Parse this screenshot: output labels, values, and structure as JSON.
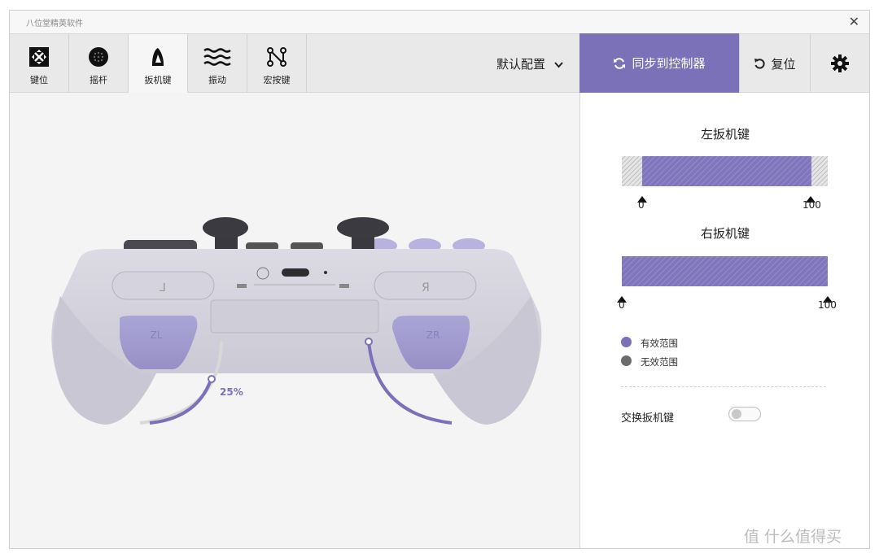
{
  "app": {
    "title": "八位堂精英软件"
  },
  "tabs": [
    {
      "label": "键位",
      "icon": "button-map-icon"
    },
    {
      "label": "摇杆",
      "icon": "joystick-icon"
    },
    {
      "label": "扳机键",
      "icon": "trigger-icon"
    },
    {
      "label": "振动",
      "icon": "vibration-icon"
    },
    {
      "label": "宏按键",
      "icon": "macro-icon"
    }
  ],
  "toolbar": {
    "profile_label": "默认配置",
    "sync_label": "同步到控制器",
    "reset_label": "复位"
  },
  "controller": {
    "left_trigger_percent_label": "25%",
    "left_trigger_travel": 0.25,
    "right_trigger_travel": 0.0
  },
  "triggers": {
    "left": {
      "title": "左扳机键",
      "min_label": "0",
      "max_label": "100",
      "min": 0,
      "max": 100,
      "dead_low": 10,
      "dead_high": 8
    },
    "right": {
      "title": "右扳机键",
      "min_label": "0",
      "max_label": "100",
      "min": 0,
      "max": 100,
      "dead_low": 0,
      "dead_high": 0
    }
  },
  "legend": {
    "effective": "有效范围",
    "ineffective": "无效范围"
  },
  "swap": {
    "label": "交换扳机键",
    "enabled": false
  },
  "colors": {
    "accent": "#7a71b8",
    "ineffective": "#6b6b6b",
    "controller_body": "#cfcdd8",
    "trigger": "#a39dd3"
  },
  "watermark": "值 什么值得买"
}
